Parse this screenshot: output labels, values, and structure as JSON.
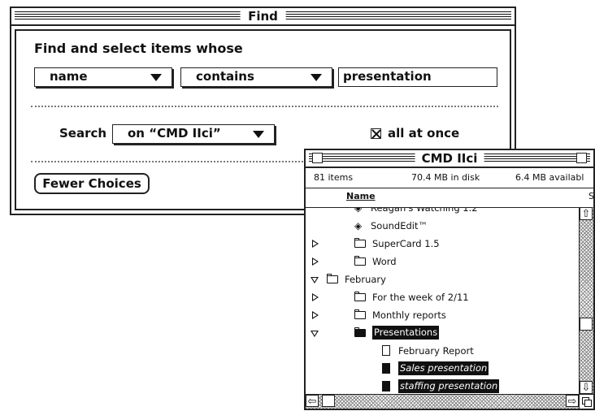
{
  "find_window": {
    "title": "Find",
    "heading": "Find and select items whose",
    "criteria": {
      "field": "name",
      "operator": "contains",
      "value": "presentation"
    },
    "search_label": "Search",
    "search_scope": "on “CMD IIci”",
    "all_at_once": {
      "label": "all at once",
      "checked": true
    },
    "fewer_choices_label": "Fewer Choices"
  },
  "finder_window": {
    "title": "CMD IIci",
    "item_count": "81 items",
    "disk_used": "70.4 MB in disk",
    "available": "6.4 MB availabl",
    "column_name": "Name",
    "column_s": "S",
    "rows": [
      {
        "name": "Reagan's Watching 1.2",
        "icon": "app-icon",
        "indent": 1,
        "disclosure": "none",
        "selected": false
      },
      {
        "name": "SoundEdit™",
        "icon": "app-icon",
        "indent": 1,
        "disclosure": "none",
        "selected": false
      },
      {
        "name": "SuperCard 1.5",
        "icon": "folder-icon",
        "indent": 1,
        "disclosure": "collapsed",
        "selected": false
      },
      {
        "name": "Word",
        "icon": "folder-icon",
        "indent": 1,
        "disclosure": "collapsed",
        "selected": false
      },
      {
        "name": "February",
        "icon": "folder-icon",
        "indent": 0,
        "disclosure": "expanded",
        "selected": false
      },
      {
        "name": "For the week of 2/11",
        "icon": "folder-icon",
        "indent": 1,
        "disclosure": "collapsed",
        "selected": false
      },
      {
        "name": "Monthly reports",
        "icon": "folder-icon",
        "indent": 1,
        "disclosure": "collapsed",
        "selected": false
      },
      {
        "name": "Presentations",
        "icon": "folder-icon",
        "indent": 1,
        "disclosure": "expanded",
        "selected": true
      },
      {
        "name": "February Report",
        "icon": "document-icon",
        "indent": 2,
        "disclosure": "none",
        "selected": false
      },
      {
        "name": "Sales presentation",
        "icon": "document-icon",
        "indent": 2,
        "disclosure": "none",
        "selected": true
      },
      {
        "name": "staffing presentation",
        "icon": "document-icon",
        "indent": 2,
        "disclosure": "none",
        "selected": true
      }
    ]
  }
}
